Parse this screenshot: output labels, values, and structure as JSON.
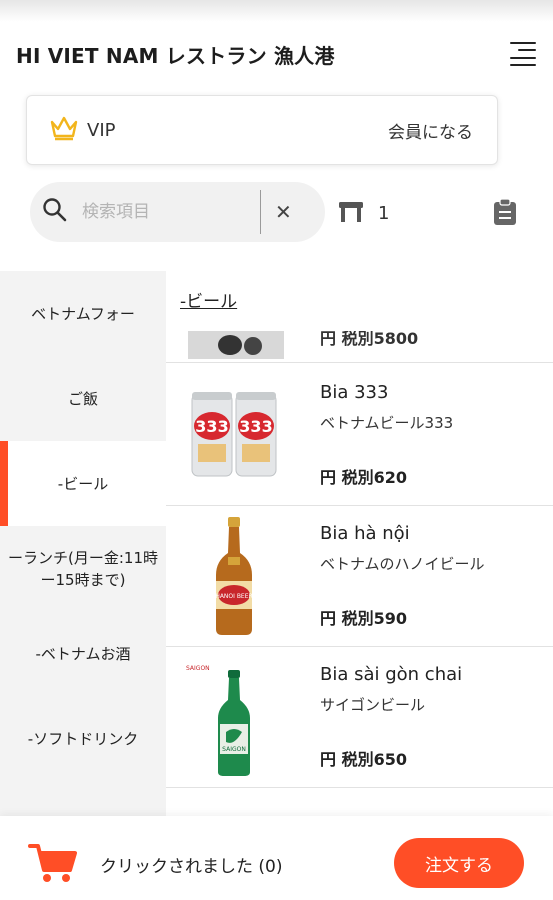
{
  "header": {
    "title": "HI VIET NAM レストラン 漁人港"
  },
  "vip": {
    "label": "VIP",
    "join_label": "会員になる"
  },
  "search": {
    "placeholder": "検索項目",
    "value": ""
  },
  "table": {
    "number": "1"
  },
  "sidebar": {
    "items": [
      {
        "label": "ベトナムフォー",
        "active": false
      },
      {
        "label": "ご飯",
        "active": false
      },
      {
        "label": "-ビール",
        "active": true
      },
      {
        "label": "ーランチ(月ー金:11時ー15時まで)",
        "active": false
      },
      {
        "label": "-ベトナムお酒",
        "active": false
      },
      {
        "label": "-ソフトドリンク",
        "active": false
      },
      {
        "label": "",
        "active": false
      }
    ]
  },
  "content": {
    "section_title": "-ビール",
    "previous_item_price": "円 税別5800",
    "products": [
      {
        "name": "Bia 333",
        "description": "ベトナムビール333",
        "price": "円 税別620"
      },
      {
        "name": "Bia hà nội",
        "description": "ベトナムのハノイビール",
        "price": "円 税別590"
      },
      {
        "name": "Bia sài gòn chai",
        "description": "サイゴンビール",
        "price": "円 税別650"
      }
    ]
  },
  "bottom_bar": {
    "cart_text": "クリックされました (0)",
    "order_button": "注文する"
  },
  "colors": {
    "accent": "#ff4e26",
    "crown": "#f2b51c"
  },
  "icons": [
    "menu-icon",
    "crown-icon",
    "search-icon",
    "close-icon",
    "table-icon",
    "clipboard-icon",
    "cart-icon"
  ]
}
